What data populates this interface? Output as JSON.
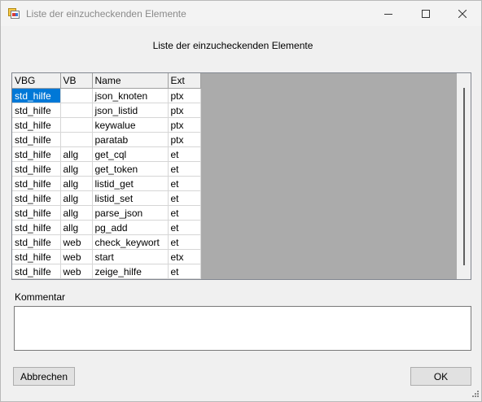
{
  "window": {
    "title": "Liste der einzucheckenden Elemente",
    "icon": "app-icon",
    "controls": {
      "minimize_icon": "minimize-icon",
      "maximize_icon": "maximize-icon",
      "close_icon": "close-icon"
    }
  },
  "heading": "Liste der einzucheckenden Elemente",
  "grid": {
    "columns": [
      "VBG",
      "VB",
      "Name",
      "Ext"
    ],
    "rows": [
      [
        "std_hilfe",
        "",
        "json_knoten",
        "ptx"
      ],
      [
        "std_hilfe",
        "",
        "json_listid",
        "ptx"
      ],
      [
        "std_hilfe",
        "",
        "keywalue",
        "ptx"
      ],
      [
        "std_hilfe",
        "",
        "paratab",
        "ptx"
      ],
      [
        "std_hilfe",
        "allg",
        "get_cql",
        "et"
      ],
      [
        "std_hilfe",
        "allg",
        "get_token",
        "et"
      ],
      [
        "std_hilfe",
        "allg",
        "listid_get",
        "et"
      ],
      [
        "std_hilfe",
        "allg",
        "listid_set",
        "et"
      ],
      [
        "std_hilfe",
        "allg",
        "parse_json",
        "et"
      ],
      [
        "std_hilfe",
        "allg",
        "pg_add",
        "et"
      ],
      [
        "std_hilfe",
        "web",
        "check_keywort",
        "et"
      ],
      [
        "std_hilfe",
        "web",
        "start",
        "etx"
      ],
      [
        "std_hilfe",
        "web",
        "zeige_hilfe",
        "et"
      ]
    ],
    "selected_row": 0
  },
  "comment": {
    "label": "Kommentar",
    "value": ""
  },
  "buttons": {
    "cancel": "Abbrechen",
    "ok": "OK"
  },
  "colors": {
    "selection": "#0078d7",
    "grid_background": "#ababab",
    "window": "#f0f0f0"
  }
}
